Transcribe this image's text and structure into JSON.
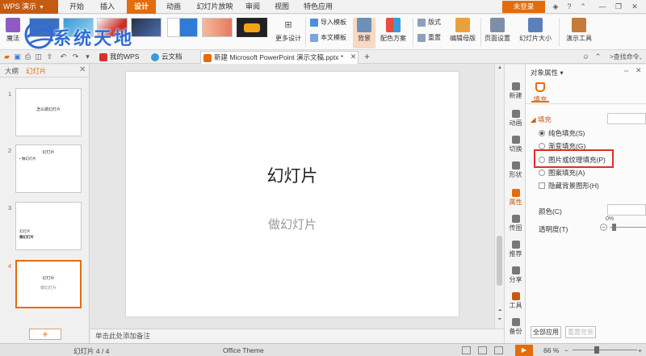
{
  "menubar": {
    "app_label": "WPS 演示",
    "tabs": [
      "开始",
      "插入",
      "设计",
      "动画",
      "幻灯片放映",
      "审阅",
      "视图",
      "特色应用"
    ],
    "active_tab": "设计",
    "login_label": "未登录"
  },
  "ribbon": {
    "magic_label": "魔法",
    "more_designs_label": "更多设计",
    "import_template_label": "导入模板",
    "this_template_label": "本文模板",
    "background_label": "背景",
    "color_scheme_label": "配色方案",
    "layout_label": "版式",
    "reset_label": "重置",
    "edit_master_label": "编辑母版",
    "page_setup_label": "页面设置",
    "slide_size_label": "幻灯片大小",
    "tools_label": "演示工具"
  },
  "watermark": {
    "text": "系统天地"
  },
  "docbar": {
    "tabs": [
      {
        "label": "我的WPS"
      },
      {
        "label": "云文档"
      },
      {
        "label": "新建 Microsoft PowerPoint 演示文稿.pptx *"
      }
    ],
    "search_text": ">查找命令、搜索"
  },
  "left_panel": {
    "outline_tab": "大纲",
    "slides_tab": "幻灯片",
    "slides": [
      {
        "num": "1",
        "lines": [
          "怎么做幻灯片"
        ]
      },
      {
        "num": "2",
        "lines": [
          "幻灯片",
          "• 做幻灯片"
        ]
      },
      {
        "num": "3",
        "lines": [
          "幻灯片",
          "做幻灯片"
        ]
      },
      {
        "num": "4",
        "lines": [
          "幻灯片",
          "做幻灯片"
        ]
      }
    ],
    "add_label": "+"
  },
  "slide": {
    "title": "幻灯片",
    "subtitle": "做幻灯片"
  },
  "notes_placeholder": "单击此处添加备注",
  "rail": {
    "items": [
      "新建",
      "动画",
      "切换",
      "形状",
      "属性",
      "传图",
      "推荐",
      "分享",
      "工具",
      "备份"
    ],
    "active": "属性"
  },
  "properties": {
    "title": "对象属性",
    "fill_tab": "填充",
    "section": "填充",
    "options": [
      {
        "label": "纯色填充(S)",
        "selected": true
      },
      {
        "label": "渐变填充(G)",
        "selected": false
      },
      {
        "label": "图片或纹理填充(P)",
        "selected": false
      },
      {
        "label": "图案填充(A)",
        "selected": false
      }
    ],
    "hide_bg_label": "隐藏背景图形(H)",
    "color_label": "颜色(C)",
    "transparency_label": "透明度(T)",
    "transparency_value": "0%",
    "apply_all_label": "全部应用",
    "reset_bg_label": "重置背景"
  },
  "status": {
    "slide_counter": "幻灯片 4 / 4",
    "theme": "Office Theme",
    "zoom": "66 %"
  },
  "colors": {
    "accent": "#e46c0a",
    "highlight": "#d9302a"
  }
}
